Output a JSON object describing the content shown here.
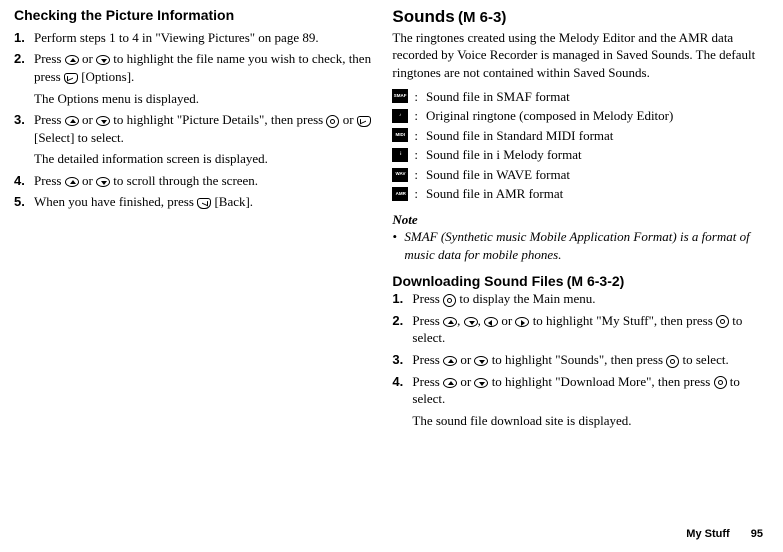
{
  "left": {
    "title": "Checking the Picture Information",
    "steps": [
      {
        "num": "1.",
        "pre": "Perform steps 1 to 4 in \"Viewing Pictures\" on page 89."
      },
      {
        "num": "2.",
        "pre": "Press ",
        "mid1": " or ",
        "mid2": " to highlight the file name you wish to check, then press ",
        "post": " [Options].",
        "sub": "The Options menu is displayed."
      },
      {
        "num": "3.",
        "pre": "Press ",
        "mid1": " or ",
        "mid2": " to highlight \"Picture Details\", then press ",
        "mid3": " or ",
        "post": " [Select] to select.",
        "sub": "The detailed information screen is displayed."
      },
      {
        "num": "4.",
        "pre": "Press ",
        "mid1": " or ",
        "post": " to scroll through the screen."
      },
      {
        "num": "5.",
        "pre": "When you have finished, press ",
        "post": " [Back]."
      }
    ]
  },
  "right": {
    "title": "Sounds",
    "menu_code": "(M 6-3)",
    "intro": "The ringtones created using the Melody Editor and the AMR data recorded by Voice Recorder is managed in Saved Sounds. The default ringtones are not contained within Saved Sounds.",
    "formats": [
      {
        "icon": "SMAF",
        "desc": "Sound file in SMAF format"
      },
      {
        "icon": "♪",
        "desc": "Original ringtone (composed in Melody Editor)"
      },
      {
        "icon": "MIDI",
        "desc": "Sound file in Standard MIDI format"
      },
      {
        "icon": "i",
        "desc": "Sound file in i Melody format"
      },
      {
        "icon": "WAV",
        "desc": "Sound file in WAVE format"
      },
      {
        "icon": "AMR",
        "desc": "Sound file in AMR format"
      }
    ],
    "note_title": "Note",
    "note_body": "SMAF (Synthetic music Mobile Application Format) is a format of music data for mobile phones.",
    "download_title": "Downloading Sound Files",
    "download_code": "(M 6-3-2)",
    "download_steps": [
      {
        "num": "1.",
        "pre": "Press ",
        "post": " to display the Main menu."
      },
      {
        "num": "2.",
        "pre": "Press ",
        "c1": ", ",
        "c2": ", ",
        "c3": " or ",
        "mid": " to highlight \"My Stuff\", then press ",
        "post": " to select."
      },
      {
        "num": "3.",
        "pre": "Press ",
        "mid1": " or ",
        "mid2": " to highlight \"Sounds\", then press ",
        "post": " to select."
      },
      {
        "num": "4.",
        "pre": "Press ",
        "mid1": " or ",
        "mid2": " to highlight \"Download More\", then press ",
        "post": " to select.",
        "sub": "The sound file download site is displayed."
      }
    ]
  },
  "footer": {
    "label": "My Stuff",
    "page": "95"
  }
}
